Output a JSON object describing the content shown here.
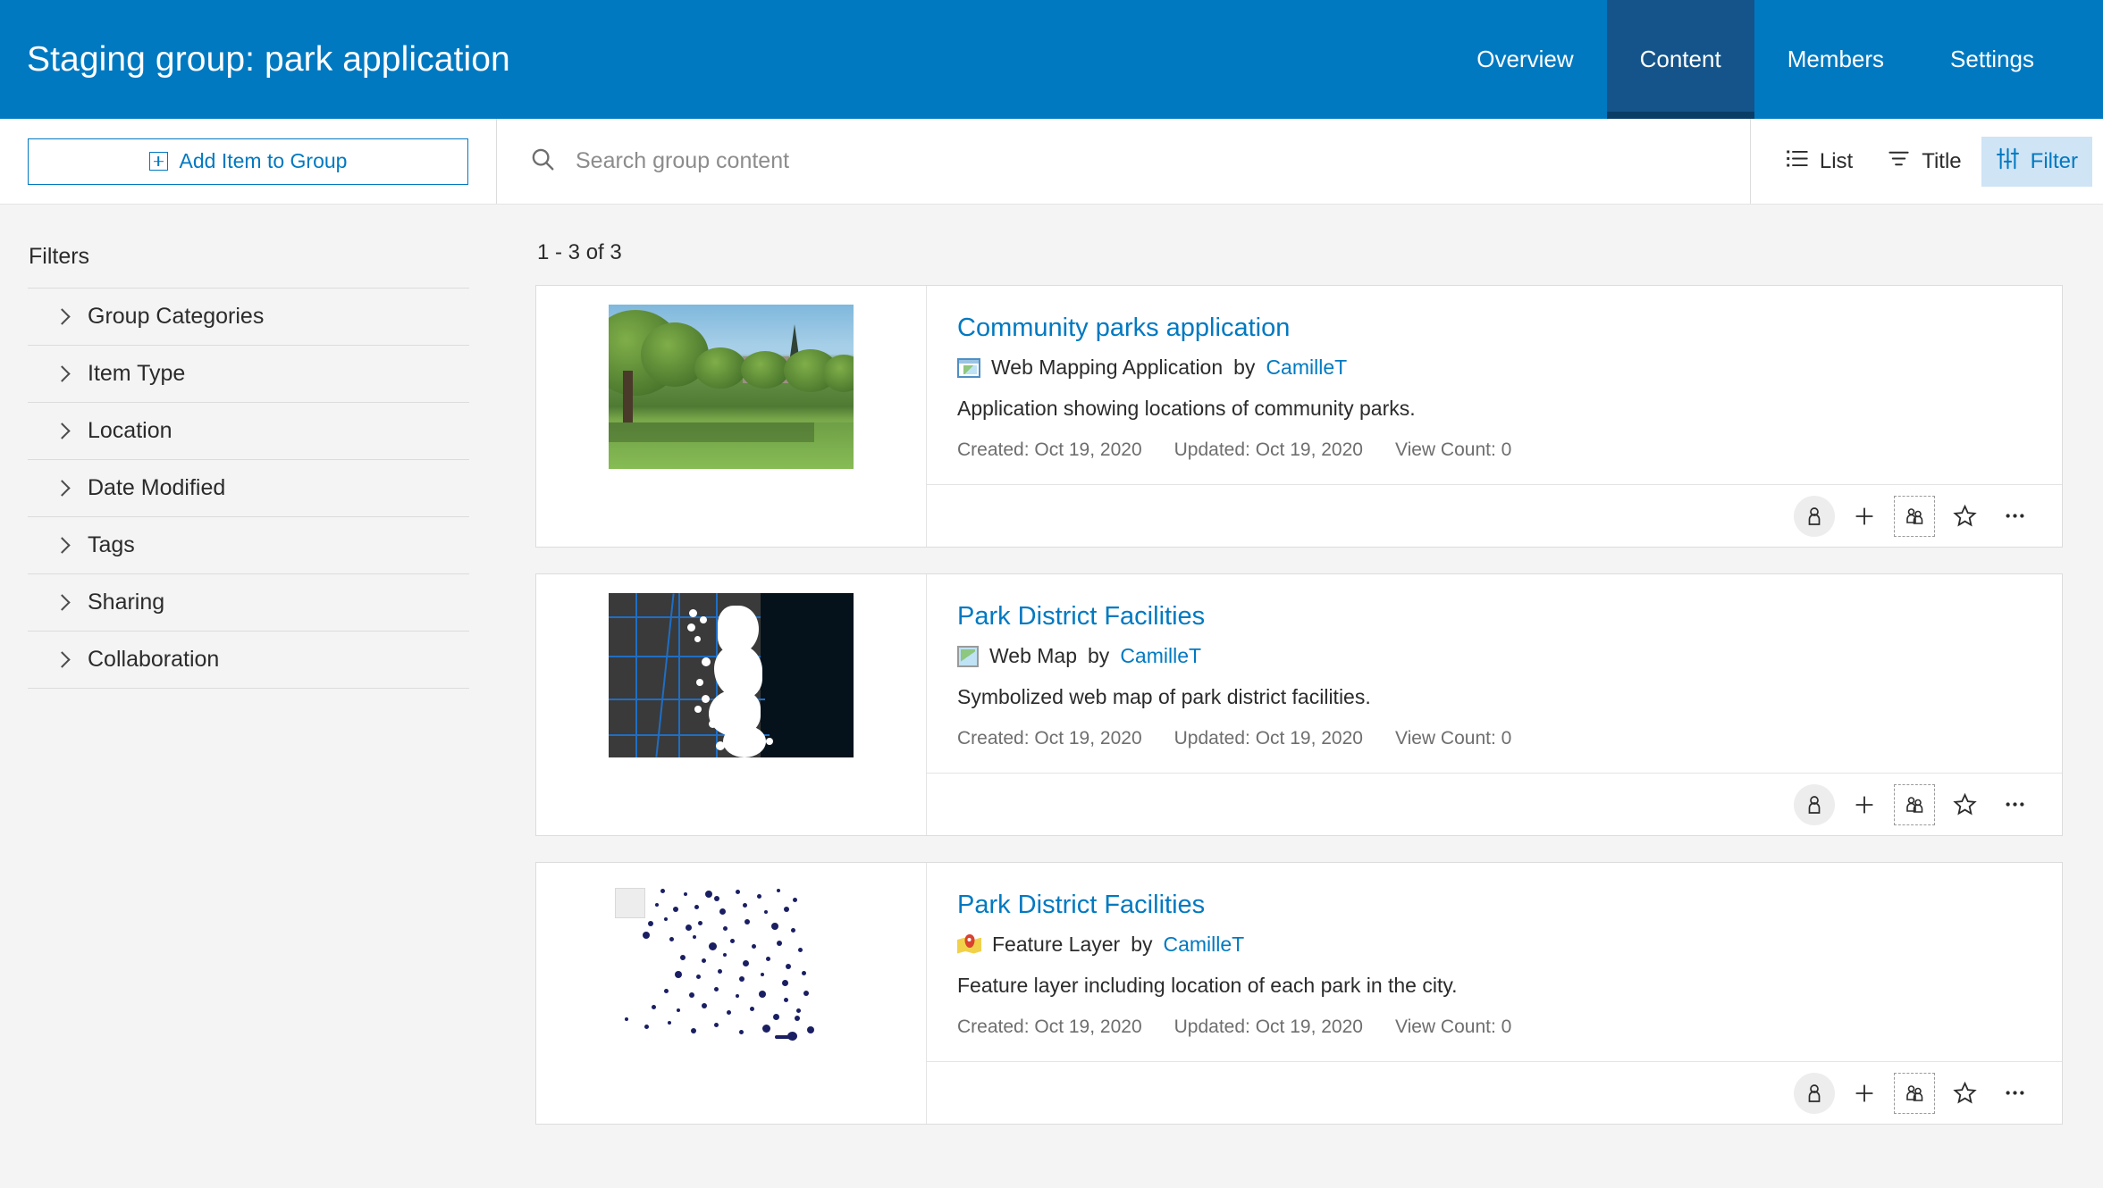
{
  "header": {
    "title": "Staging group: park application",
    "tabs": [
      {
        "label": "Overview",
        "active": false
      },
      {
        "label": "Content",
        "active": true
      },
      {
        "label": "Members",
        "active": false
      },
      {
        "label": "Settings",
        "active": false
      }
    ],
    "bg_color": "#0079c1",
    "active_tab_color": "#14548a"
  },
  "toolbar": {
    "add_item_label": "Add Item to Group",
    "add_item_icon": "plus-square-icon",
    "search_placeholder": "Search group content",
    "search_value": "",
    "search_icon": "search-icon",
    "view_list_label": "List",
    "view_list_icon": "list-icon",
    "sort_title_label": "Title",
    "sort_title_icon": "sort-icon",
    "filter_label": "Filter",
    "filter_icon": "filter-sliders-icon",
    "filter_active": true,
    "filter_active_bg": "#cfe4f5",
    "accent_color": "#0079c1"
  },
  "sidebar": {
    "title": "Filters",
    "items": [
      {
        "label": "Group Categories",
        "icon": "chevron-right-icon"
      },
      {
        "label": "Item Type",
        "icon": "chevron-right-icon"
      },
      {
        "label": "Location",
        "icon": "chevron-right-icon"
      },
      {
        "label": "Date Modified",
        "icon": "chevron-right-icon"
      },
      {
        "label": "Tags",
        "icon": "chevron-right-icon"
      },
      {
        "label": "Sharing",
        "icon": "chevron-right-icon"
      },
      {
        "label": "Collaboration",
        "icon": "chevron-right-icon"
      }
    ]
  },
  "results": {
    "count_label": "1 - 3 of 3",
    "items": [
      {
        "title": "Community parks application",
        "type": "Web Mapping Application",
        "type_icon": "web-mapping-application-icon",
        "by_label": "by",
        "owner": "CamilleT",
        "snippet": "Application showing locations of community parks.",
        "created": "Created: Oct 19, 2020",
        "updated": "Updated: Oct 19, 2020",
        "view_count": "View Count: 0",
        "thumbnail": "park-photo-thumbnail"
      },
      {
        "title": "Park District Facilities",
        "type": "Web Map",
        "type_icon": "web-map-icon",
        "by_label": "by",
        "owner": "CamilleT",
        "snippet": "Symbolized web map of park district facilities.",
        "created": "Created: Oct 19, 2020",
        "updated": "Updated: Oct 19, 2020",
        "view_count": "View Count: 0",
        "thumbnail": "dark-basemap-thumbnail"
      },
      {
        "title": "Park District Facilities",
        "type": "Feature Layer",
        "type_icon": "feature-layer-icon",
        "by_label": "by",
        "owner": "CamilleT",
        "snippet": "Feature layer including location of each park in the city.",
        "created": "Created: Oct 19, 2020",
        "updated": "Updated: Oct 19, 2020",
        "view_count": "View Count: 0",
        "thumbnail": "scatter-points-thumbnail"
      }
    ],
    "actions": [
      {
        "name": "share-owner-icon"
      },
      {
        "name": "add-icon"
      },
      {
        "name": "share-group-icon"
      },
      {
        "name": "favorite-star-icon"
      },
      {
        "name": "more-options-icon"
      }
    ]
  }
}
